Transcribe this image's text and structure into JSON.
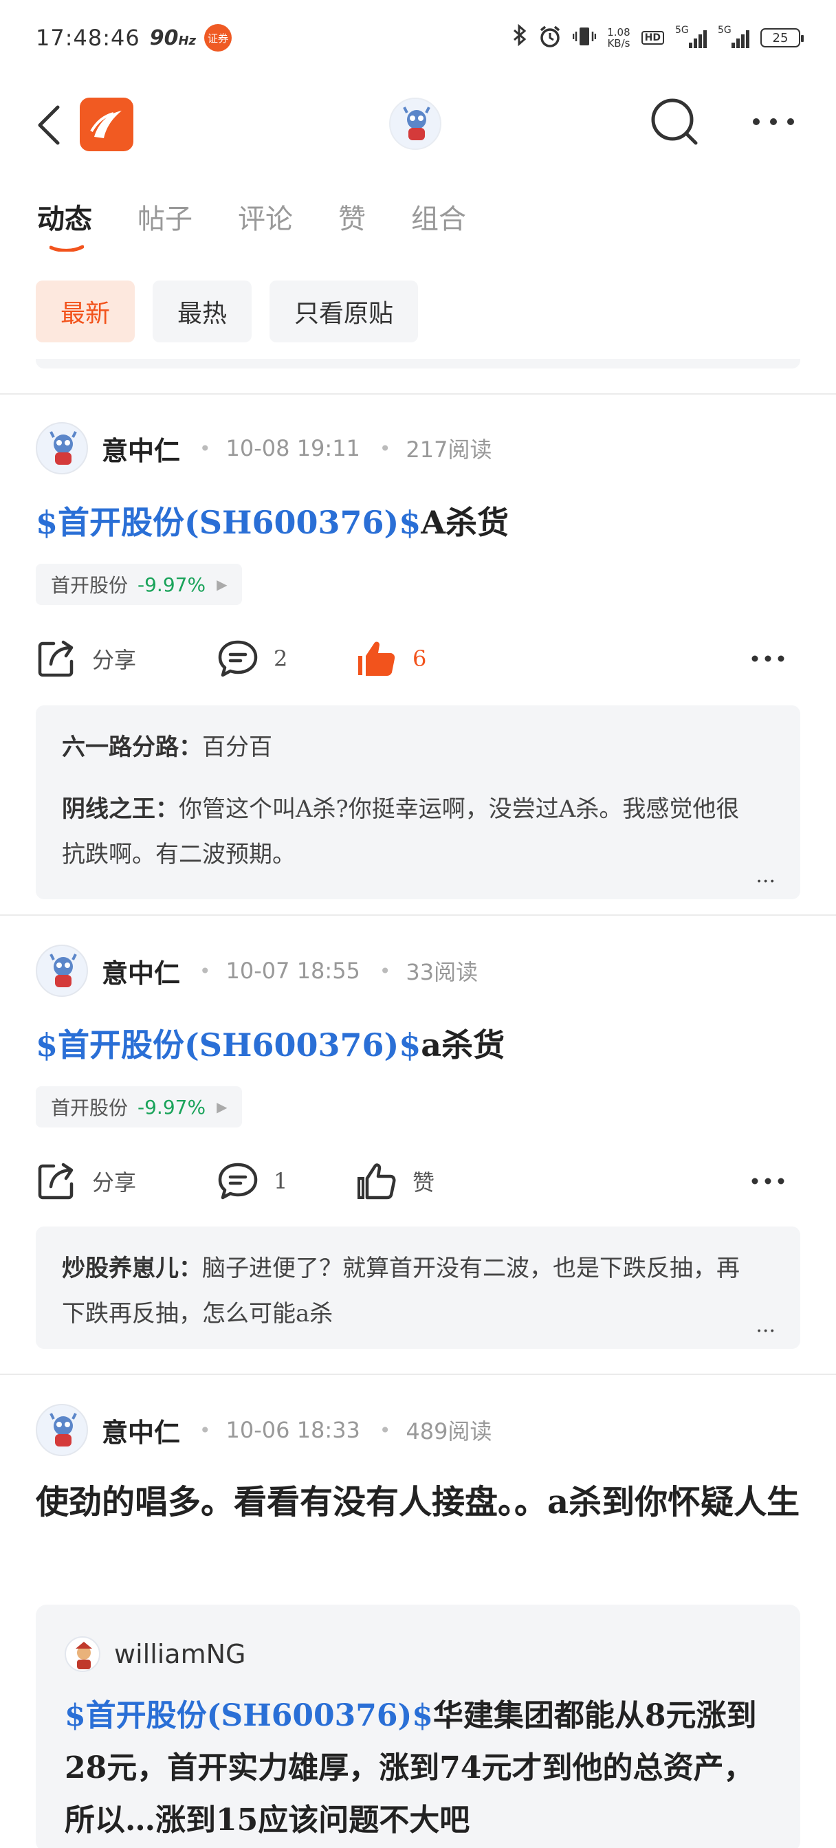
{
  "status_bar": {
    "time": "17:48:46",
    "refresh": "90",
    "refresh_unit": "Hz",
    "app_badge": "证券",
    "net_speed": "1.08",
    "net_unit": "KB/s",
    "hd1": "HD",
    "sig1": "5G",
    "sig2": "5G",
    "battery": "25"
  },
  "tabs": [
    "动态",
    "帖子",
    "评论",
    "赞",
    "组合"
  ],
  "filters": [
    "最新",
    "最热",
    "只看原贴"
  ],
  "colors": {
    "accent": "#f2531c",
    "link": "#2a6fd6",
    "up_green": "#1aa35a"
  },
  "posts": [
    {
      "user": "意中仁",
      "time": "10-08 19:11",
      "reads": "217阅读",
      "title_link": "$首开股份(SH600376)$",
      "title_rest": "A杀货",
      "stock_name": "首开股份",
      "stock_change": "-9.97%",
      "share_label": "分享",
      "comment_count": "2",
      "like_label": "6",
      "replies": [
        {
          "name": "六一路分路：",
          "text": "百分百"
        },
        {
          "name": "阴线之王：",
          "text": "你管这个叫A杀?你挺幸运啊，没尝过A杀。我感觉他很抗跌啊。有二波预期。"
        }
      ],
      "more_text": "..."
    },
    {
      "user": "意中仁",
      "time": "10-07 18:55",
      "reads": "33阅读",
      "title_link": "$首开股份(SH600376)$",
      "title_rest": "a杀货",
      "stock_name": "首开股份",
      "stock_change": "-9.97%",
      "share_label": "分享",
      "comment_count": "1",
      "like_label": "赞",
      "replies": [
        {
          "name": "炒股养崽儿：",
          "text": "脑子进便了？就算首开没有二波，也是下跌反抽，再下跌再反抽，怎么可能a杀"
        }
      ],
      "more_text": "..."
    },
    {
      "user": "意中仁",
      "time": "10-06 18:33",
      "reads": "489阅读",
      "body": "使劲的唱多。看看有没有人接盘。。a杀到你怀疑人生",
      "quote": {
        "user": "williamNG",
        "link": "$首开股份(SH600376)$",
        "text": "华建集团都能从8元涨到28元，首开实力雄厚，涨到74元才到他的总资产，所以…涨到15应该问题不大吧"
      }
    }
  ]
}
